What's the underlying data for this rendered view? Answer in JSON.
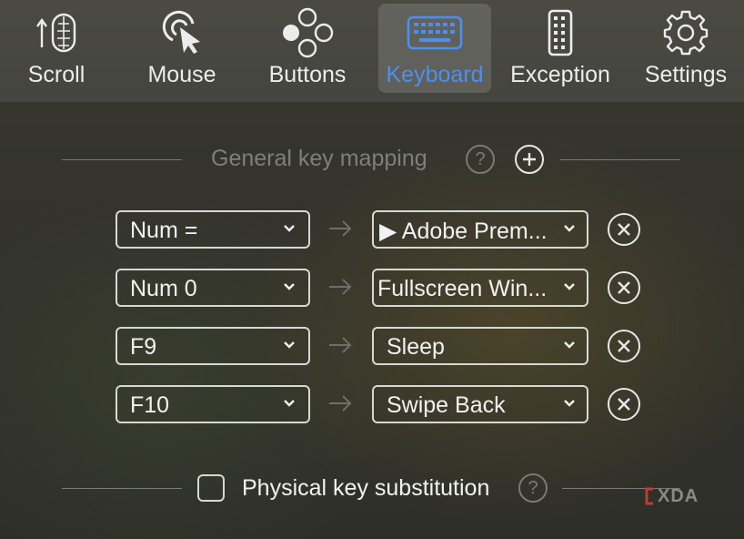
{
  "toolbar": {
    "tabs": [
      {
        "label": "Scroll",
        "icon": "scroll-wheel-icon",
        "active": false
      },
      {
        "label": "Mouse",
        "icon": "mouse-click-icon",
        "active": false
      },
      {
        "label": "Buttons",
        "icon": "buttons-icon",
        "active": false
      },
      {
        "label": "Keyboard",
        "icon": "keyboard-icon",
        "active": true
      },
      {
        "label": "Exception",
        "icon": "phone-device-icon",
        "active": false
      },
      {
        "label": "Settings",
        "icon": "gear-icon",
        "active": false
      }
    ]
  },
  "section": {
    "title": "General key mapping",
    "help_glyph": "?"
  },
  "mappings": [
    {
      "key": "Num =",
      "action": "▶ Adobe Prem..."
    },
    {
      "key": "Num 0",
      "action": "Fullscreen Win..."
    },
    {
      "key": "F9",
      "action": "Sleep"
    },
    {
      "key": "F10",
      "action": "Swipe Back"
    }
  ],
  "bottom": {
    "label": "Physical key substitution",
    "checked": false,
    "help_glyph": "?"
  },
  "watermark": {
    "text": "XDA"
  },
  "colors": {
    "accent": "#4d8ff0",
    "muted": "#7f7f78"
  }
}
